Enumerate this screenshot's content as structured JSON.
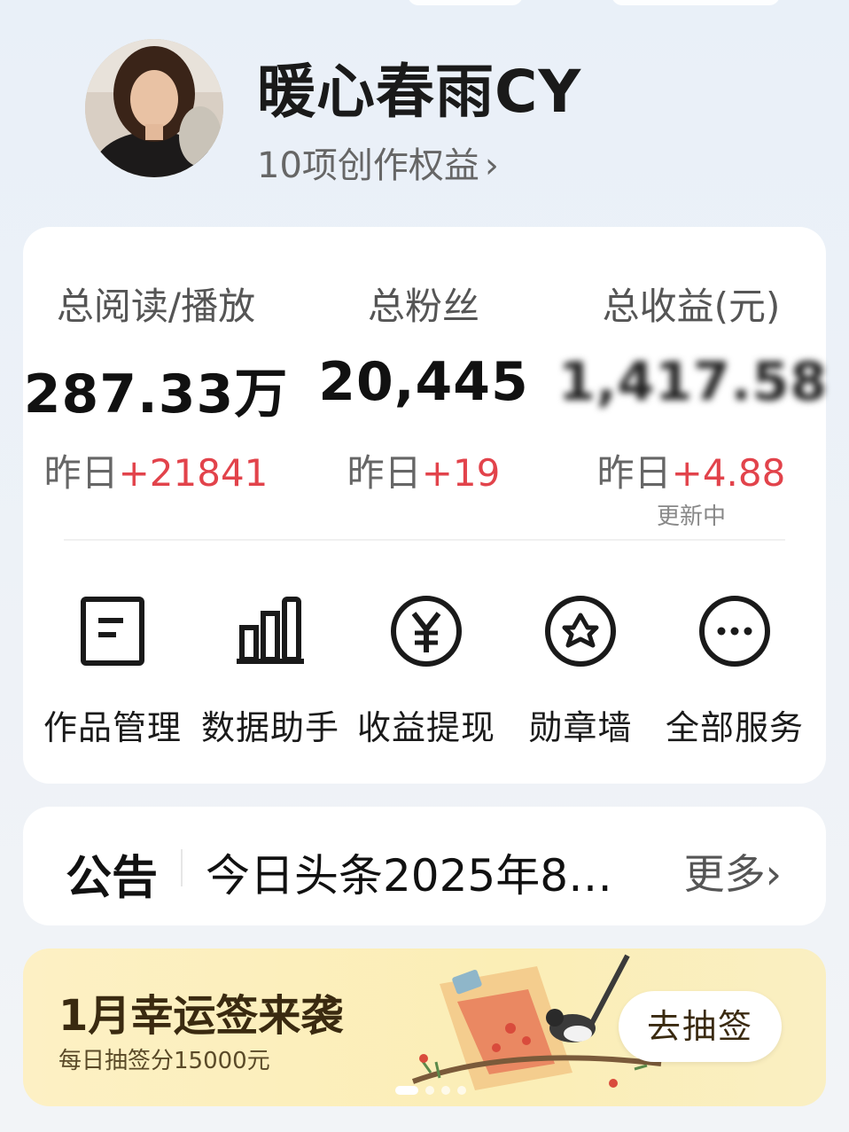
{
  "profile": {
    "name": "暖心春雨CY",
    "benefits": "10项创作权益",
    "benefits_chevron": "›"
  },
  "stats": [
    {
      "label": "总阅读/播放",
      "value": "287.33万",
      "delta_prefix": "昨日",
      "delta": "+21841"
    },
    {
      "label": "总粉丝",
      "value": "20,445",
      "delta_prefix": "昨日",
      "delta": "+19"
    },
    {
      "label": "总收益(元)",
      "value": "1,417.58",
      "delta_prefix": "昨日",
      "delta": "+4.88",
      "note": "更新中"
    }
  ],
  "services": [
    {
      "label": "作品管理",
      "icon": "document-icon"
    },
    {
      "label": "数据助手",
      "icon": "bar-chart-icon"
    },
    {
      "label": "收益提现",
      "icon": "yen-circle-icon"
    },
    {
      "label": "勋章墙",
      "icon": "star-badge-icon"
    },
    {
      "label": "全部服务",
      "icon": "more-circle-icon"
    }
  ],
  "notice": {
    "title": "公告",
    "text": "今日头条2025年8…",
    "more": "更多›"
  },
  "banner": {
    "title": "1月幸运签来袭",
    "subtitle": "每日抽签分15000元",
    "button": "去抽签"
  },
  "colors": {
    "positive_delta": "#e2434b",
    "banner_bg": "#fbeeb6"
  }
}
